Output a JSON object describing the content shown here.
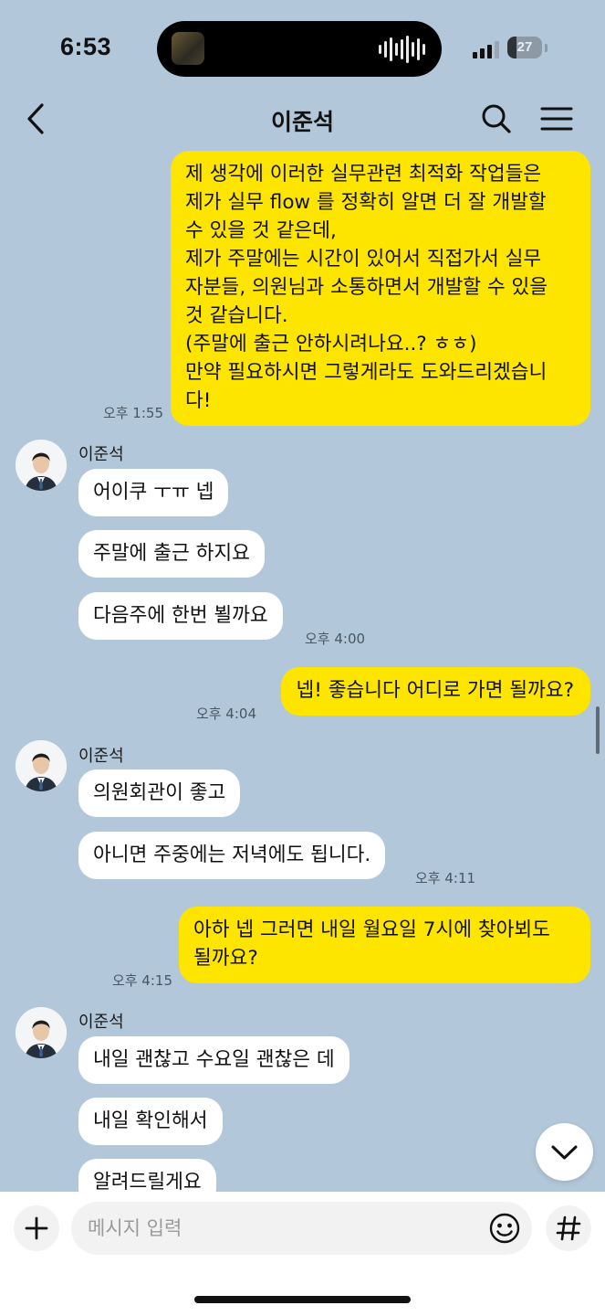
{
  "status_bar": {
    "time": "6:53",
    "battery": "27",
    "battery_level": 0.27
  },
  "header": {
    "title": "이준석"
  },
  "messages": [
    {
      "from": "me",
      "text": "제 생각에 이러한 실무관련 최적화 작업들은\n제가 실무 flow 를 정확히 알면 더 잘 개발할\n수 있을 것 같은데,\n제가 주말에는 시간이 있어서 직접가서 실무\n자분들, 의원님과 소통하면서 개발할 수 있을\n것 같습니다.\n(주말에 출근 안하시려나요..? ㅎㅎ)\n만약 필요하시면 그렇게라도 도와드리겠습니\n다!",
      "time": "오후 1:55"
    },
    {
      "from": "them",
      "sender": "이준석",
      "text": "어이쿠 ㅜㅠ 넵"
    },
    {
      "from": "them",
      "text": "주말에 출근 하지요"
    },
    {
      "from": "them",
      "text": "다음주에 한번 뵐까요",
      "time": "오후 4:00"
    },
    {
      "from": "me",
      "text": "넵! 좋습니다 어디로 가면 될까요?",
      "time": "오후 4:04"
    },
    {
      "from": "them",
      "sender": "이준석",
      "text": "의원회관이 좋고"
    },
    {
      "from": "them",
      "text": "아니면 주중에는 저녁에도 됩니다.",
      "time": "오후 4:11"
    },
    {
      "from": "me",
      "text": "아하 넵 그러면 내일 월요일 7시에 찾아뵈도\n될까요?",
      "time": "오후 4:15"
    },
    {
      "from": "them",
      "sender": "이준석",
      "text": "내일 괜찮고 수요일 괜찮은 데"
    },
    {
      "from": "them",
      "text": "내일 확인해서"
    },
    {
      "from": "them",
      "text": "알려드릴게요"
    }
  ],
  "composer": {
    "placeholder": "메시지 입력"
  },
  "icons": {
    "back": "chevron-left-icon",
    "search": "search-icon",
    "menu": "hamburger-menu-icon",
    "scroll_down": "chevron-down-icon",
    "add": "plus-icon",
    "emoji": "smiley-icon",
    "hashtag": "hash-icon"
  },
  "colors": {
    "background": "#b2c7d9",
    "my_bubble": "#fee500",
    "their_bubble": "#ffffff"
  }
}
